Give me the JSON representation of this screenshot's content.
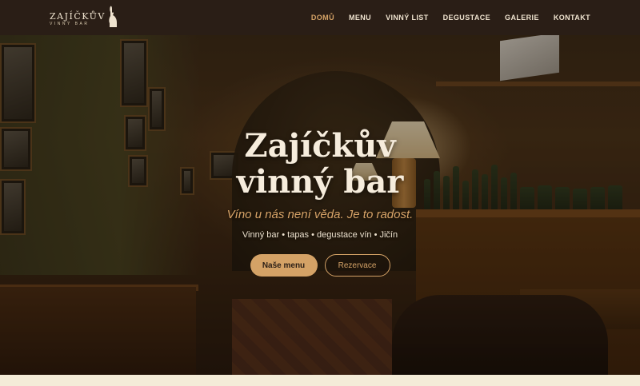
{
  "brand": {
    "name": "ZAJÍČKŮV",
    "subtitle": "VINNÝ BAR"
  },
  "nav": {
    "items": [
      {
        "label": "DOMŮ",
        "active": true
      },
      {
        "label": "MENU"
      },
      {
        "label": "VINNÝ LIST"
      },
      {
        "label": "DEGUSTACE"
      },
      {
        "label": "GALERIE"
      },
      {
        "label": "KONTAKT"
      }
    ]
  },
  "hero": {
    "title_line1": "Zajíčkův",
    "title_line2": "vinný bar",
    "tagline": "Víno u nás není věda. Je to radost.",
    "subtitle": "Vinný bar • tapas • degustace vín • Jičín",
    "primary_button": "Naše menu",
    "secondary_button": "Rezervace"
  },
  "colors": {
    "header_bg": "#2a1e16",
    "accent": "#d4a266",
    "text_light": "#efe3cf",
    "page_bg": "#f4ecd8"
  }
}
